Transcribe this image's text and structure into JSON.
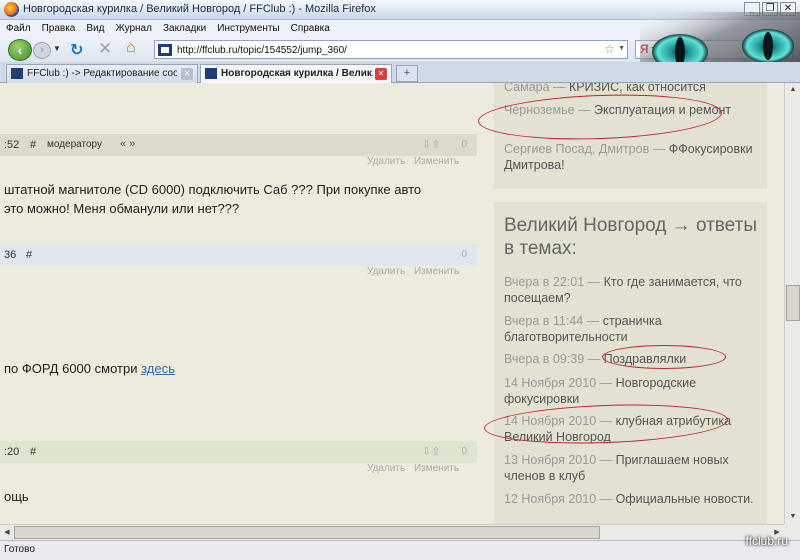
{
  "window": {
    "title": "Новгородская курилка / Великий Новгород / FFClub :) - Mozilla Firefox",
    "controls": [
      "_",
      "❐",
      "✕"
    ]
  },
  "menu": [
    "Файл",
    "Правка",
    "Вид",
    "Журнал",
    "Закладки",
    "Инструменты",
    "Справка"
  ],
  "nav": {
    "url": "http://ffclub.ru/topic/154552/jump_360/",
    "search_placeholder": "Яндекс",
    "search_engine_letter": "Я"
  },
  "tabs": [
    {
      "label": "FFClub :) -> Редактирование сообще...",
      "active": false
    },
    {
      "label": "Новгородская курилка / Велик...",
      "active": true
    }
  ],
  "new_tab_label": "+",
  "posts": [
    {
      "time": ":52",
      "hash": "#",
      "extra": "модератору",
      "quotes": "« »",
      "count": "0",
      "actions": [
        "Удалить",
        "Изменить"
      ],
      "lines": [
        "штатной магнитоле (CD 6000) подключить Саб ??? При покупке авто",
        "это можно! Меня обманули или нет???"
      ]
    },
    {
      "time": "36",
      "hash": "#",
      "count": "0",
      "actions": [
        "Удалить",
        "Изменить"
      ],
      "text_before": "по ФОРД 6000 смотри ",
      "link": "здесь"
    },
    {
      "time": ":20",
      "hash": "#",
      "count": "0",
      "actions": [
        "Удалить",
        "Изменить"
      ],
      "lines": [
        "ощь"
      ]
    }
  ],
  "sidebar_top": [
    {
      "prefix": "Самара — ",
      "text": "КРИЗИС, как относится"
    },
    {
      "prefix": "Черноземье — ",
      "text": "Эксплуатация и ремонт"
    },
    {
      "prefix": "Сергиев Посад, Дмитров — ",
      "text": "ФФокусировки Дмитрова!"
    }
  ],
  "sidebar_main": {
    "title": "Великий Новгород → ответы в темах:",
    "items": [
      {
        "date": "Вчера в 22:01 — ",
        "topic": "Кто где занимается, что посещаем?"
      },
      {
        "date": "Вчера в 11:44 — ",
        "topic": "страничка благотворительности"
      },
      {
        "date": "Вчера в 09:39 — ",
        "topic": "Поздравлялки"
      },
      {
        "date": "14 Ноября 2010 — ",
        "topic": "Новгородские фокусировки"
      },
      {
        "date": "14 Ноября 2010 — ",
        "topic": "клубная атрибутика Великий Новгород"
      },
      {
        "date": "13 Ноября 2010 — ",
        "topic": "Приглашаем новых членов в клуб"
      },
      {
        "date": "12 Ноября 2010 — ",
        "topic": "Официальные новости."
      }
    ]
  },
  "status": "Готово",
  "watermark": "ffclub.ru",
  "colors": {
    "annotation": "#c4232b",
    "link": "#3a66a8",
    "page_bg": "#ecebde"
  }
}
